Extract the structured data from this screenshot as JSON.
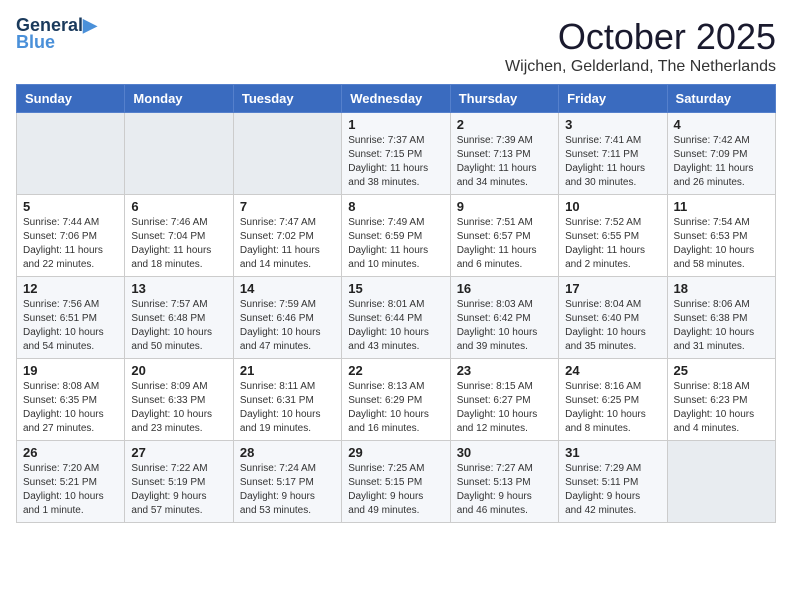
{
  "logo": {
    "line1": "General",
    "line2": "Blue"
  },
  "title": "October 2025",
  "location": "Wijchen, Gelderland, The Netherlands",
  "days_of_week": [
    "Sunday",
    "Monday",
    "Tuesday",
    "Wednesday",
    "Thursday",
    "Friday",
    "Saturday"
  ],
  "weeks": [
    [
      {
        "day": "",
        "info": ""
      },
      {
        "day": "",
        "info": ""
      },
      {
        "day": "",
        "info": ""
      },
      {
        "day": "1",
        "info": "Sunrise: 7:37 AM\nSunset: 7:15 PM\nDaylight: 11 hours\nand 38 minutes."
      },
      {
        "day": "2",
        "info": "Sunrise: 7:39 AM\nSunset: 7:13 PM\nDaylight: 11 hours\nand 34 minutes."
      },
      {
        "day": "3",
        "info": "Sunrise: 7:41 AM\nSunset: 7:11 PM\nDaylight: 11 hours\nand 30 minutes."
      },
      {
        "day": "4",
        "info": "Sunrise: 7:42 AM\nSunset: 7:09 PM\nDaylight: 11 hours\nand 26 minutes."
      }
    ],
    [
      {
        "day": "5",
        "info": "Sunrise: 7:44 AM\nSunset: 7:06 PM\nDaylight: 11 hours\nand 22 minutes."
      },
      {
        "day": "6",
        "info": "Sunrise: 7:46 AM\nSunset: 7:04 PM\nDaylight: 11 hours\nand 18 minutes."
      },
      {
        "day": "7",
        "info": "Sunrise: 7:47 AM\nSunset: 7:02 PM\nDaylight: 11 hours\nand 14 minutes."
      },
      {
        "day": "8",
        "info": "Sunrise: 7:49 AM\nSunset: 6:59 PM\nDaylight: 11 hours\nand 10 minutes."
      },
      {
        "day": "9",
        "info": "Sunrise: 7:51 AM\nSunset: 6:57 PM\nDaylight: 11 hours\nand 6 minutes."
      },
      {
        "day": "10",
        "info": "Sunrise: 7:52 AM\nSunset: 6:55 PM\nDaylight: 11 hours\nand 2 minutes."
      },
      {
        "day": "11",
        "info": "Sunrise: 7:54 AM\nSunset: 6:53 PM\nDaylight: 10 hours\nand 58 minutes."
      }
    ],
    [
      {
        "day": "12",
        "info": "Sunrise: 7:56 AM\nSunset: 6:51 PM\nDaylight: 10 hours\nand 54 minutes."
      },
      {
        "day": "13",
        "info": "Sunrise: 7:57 AM\nSunset: 6:48 PM\nDaylight: 10 hours\nand 50 minutes."
      },
      {
        "day": "14",
        "info": "Sunrise: 7:59 AM\nSunset: 6:46 PM\nDaylight: 10 hours\nand 47 minutes."
      },
      {
        "day": "15",
        "info": "Sunrise: 8:01 AM\nSunset: 6:44 PM\nDaylight: 10 hours\nand 43 minutes."
      },
      {
        "day": "16",
        "info": "Sunrise: 8:03 AM\nSunset: 6:42 PM\nDaylight: 10 hours\nand 39 minutes."
      },
      {
        "day": "17",
        "info": "Sunrise: 8:04 AM\nSunset: 6:40 PM\nDaylight: 10 hours\nand 35 minutes."
      },
      {
        "day": "18",
        "info": "Sunrise: 8:06 AM\nSunset: 6:38 PM\nDaylight: 10 hours\nand 31 minutes."
      }
    ],
    [
      {
        "day": "19",
        "info": "Sunrise: 8:08 AM\nSunset: 6:35 PM\nDaylight: 10 hours\nand 27 minutes."
      },
      {
        "day": "20",
        "info": "Sunrise: 8:09 AM\nSunset: 6:33 PM\nDaylight: 10 hours\nand 23 minutes."
      },
      {
        "day": "21",
        "info": "Sunrise: 8:11 AM\nSunset: 6:31 PM\nDaylight: 10 hours\nand 19 minutes."
      },
      {
        "day": "22",
        "info": "Sunrise: 8:13 AM\nSunset: 6:29 PM\nDaylight: 10 hours\nand 16 minutes."
      },
      {
        "day": "23",
        "info": "Sunrise: 8:15 AM\nSunset: 6:27 PM\nDaylight: 10 hours\nand 12 minutes."
      },
      {
        "day": "24",
        "info": "Sunrise: 8:16 AM\nSunset: 6:25 PM\nDaylight: 10 hours\nand 8 minutes."
      },
      {
        "day": "25",
        "info": "Sunrise: 8:18 AM\nSunset: 6:23 PM\nDaylight: 10 hours\nand 4 minutes."
      }
    ],
    [
      {
        "day": "26",
        "info": "Sunrise: 7:20 AM\nSunset: 5:21 PM\nDaylight: 10 hours\nand 1 minute."
      },
      {
        "day": "27",
        "info": "Sunrise: 7:22 AM\nSunset: 5:19 PM\nDaylight: 9 hours\nand 57 minutes."
      },
      {
        "day": "28",
        "info": "Sunrise: 7:24 AM\nSunset: 5:17 PM\nDaylight: 9 hours\nand 53 minutes."
      },
      {
        "day": "29",
        "info": "Sunrise: 7:25 AM\nSunset: 5:15 PM\nDaylight: 9 hours\nand 49 minutes."
      },
      {
        "day": "30",
        "info": "Sunrise: 7:27 AM\nSunset: 5:13 PM\nDaylight: 9 hours\nand 46 minutes."
      },
      {
        "day": "31",
        "info": "Sunrise: 7:29 AM\nSunset: 5:11 PM\nDaylight: 9 hours\nand 42 minutes."
      },
      {
        "day": "",
        "info": ""
      }
    ]
  ]
}
